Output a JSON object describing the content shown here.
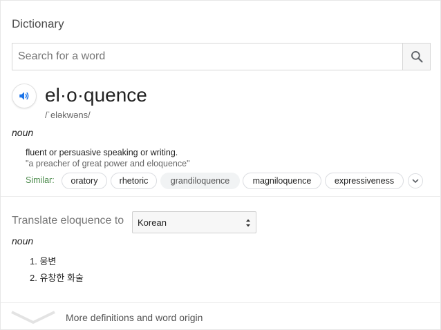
{
  "header": {
    "title": "Dictionary"
  },
  "search": {
    "placeholder": "Search for a word",
    "value": ""
  },
  "entry": {
    "headword": "el·o·quence",
    "phonetic": "/ˈeləkwəns/",
    "part_of_speech": "noun",
    "definition": "fluent or persuasive speaking or writing.",
    "example": "\"a preacher of great power and eloquence\"",
    "similar_label": "Similar:",
    "similar": [
      "oratory",
      "rhetoric",
      "grandiloquence",
      "magniloquence",
      "expressiveness"
    ]
  },
  "translate": {
    "label": "Translate eloquence to",
    "language": "Korean",
    "part_of_speech": "noun",
    "items": [
      "1. 웅변",
      "2. 유창한 화술"
    ]
  },
  "footer": {
    "more_label": "More definitions and word origin"
  },
  "colors": {
    "accent_blue": "#1a73e8",
    "similar_green": "#4a8a4a"
  },
  "icons": {
    "search": "search-icon",
    "speaker": "speaker-icon",
    "expand": "chevron-down-icon",
    "more": "chevron-down-icon"
  }
}
